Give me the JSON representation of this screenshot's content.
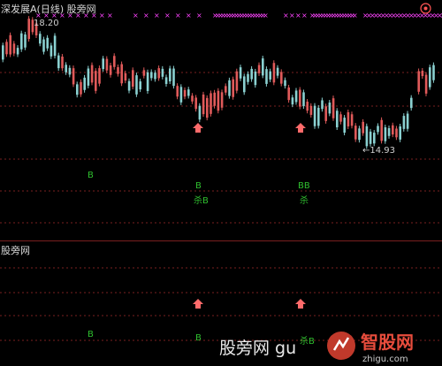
{
  "chart": {
    "stock_title": "深发展A(日线) 股旁网",
    "indicator_title": "股旁网",
    "high_label": "18.20",
    "low_label": "←14.93",
    "top_signals": [
      {
        "text": "B"
      },
      {
        "text": "B"
      },
      {
        "text": "杀B"
      },
      {
        "text": "BB"
      },
      {
        "text": "杀"
      }
    ],
    "bottom_signals": [
      {
        "text": "B"
      },
      {
        "text": "B"
      },
      {
        "text": "杀B"
      }
    ],
    "colors": {
      "up": "#e05a5a",
      "down": "#8ad0d0",
      "grid": "#7a1f1f",
      "marker": "#ff44ff",
      "arrow": "#ff6b6b",
      "signal": "#2fbf2f"
    }
  },
  "watermark": {
    "left_text": "股旁网 gu",
    "logo_text": "智股网",
    "logo_sub": "zhigu.com"
  }
}
